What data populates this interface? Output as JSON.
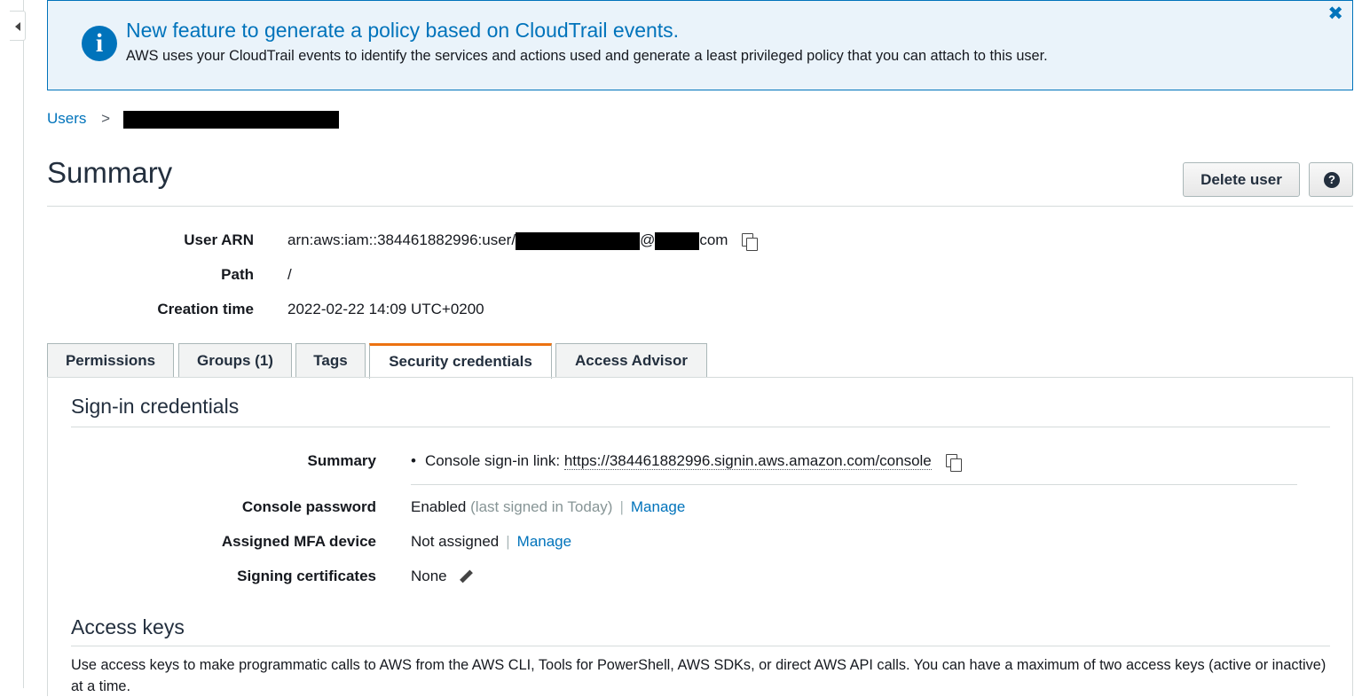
{
  "banner": {
    "title": "New feature to generate a policy based on CloudTrail events.",
    "text": "AWS uses your CloudTrail events to identify the services and actions used and generate a least privileged policy that you can attach to this user.",
    "close": "✖"
  },
  "breadcrumb": {
    "parent": "Users",
    "separator": ">"
  },
  "header": {
    "title": "Summary",
    "delete_label": "Delete user",
    "help_label": "?"
  },
  "summary": {
    "arn_label": "User ARN",
    "arn_prefix": "arn:aws:iam::384461882996:user/",
    "arn_at": "@",
    "arn_suffix": "com",
    "path_label": "Path",
    "path_value": "/",
    "creation_label": "Creation time",
    "creation_value": "2022-02-22 14:09 UTC+0200"
  },
  "tabs": [
    {
      "label": "Permissions"
    },
    {
      "label": "Groups (1)"
    },
    {
      "label": "Tags"
    },
    {
      "label": "Security credentials",
      "active": true
    },
    {
      "label": "Access Advisor"
    }
  ],
  "signin": {
    "title": "Sign-in credentials",
    "summary_label": "Summary",
    "summary_bullet": "•",
    "summary_prefix": "Console sign-in link:",
    "summary_link": "https://384461882996.signin.aws.amazon.com/console",
    "password_label": "Console password",
    "password_value": "Enabled",
    "password_note": "(last signed in Today)",
    "password_action": "Manage",
    "mfa_label": "Assigned MFA device",
    "mfa_value": "Not assigned",
    "mfa_action": "Manage",
    "certs_label": "Signing certificates",
    "certs_value": "None",
    "pipe": "|"
  },
  "access_keys": {
    "title": "Access keys",
    "text": "Use access keys to make programmatic calls to AWS from the AWS CLI, Tools for PowerShell, AWS SDKs, or direct AWS API calls. You can have a maximum of two access keys (active or inactive) at a time."
  }
}
